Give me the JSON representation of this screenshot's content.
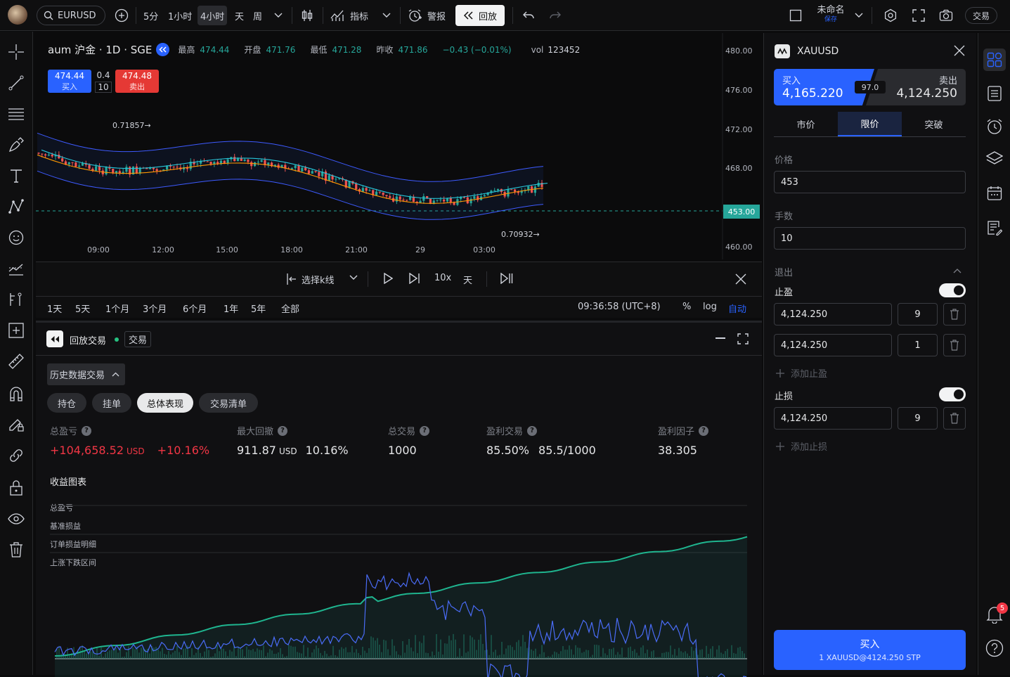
{
  "topbar": {
    "symbol": "EURUSD",
    "intervals": [
      "5分",
      "1小时",
      "4小时",
      "天",
      "周"
    ],
    "active_interval": "4小时",
    "indicators_label": "指标",
    "alert_label": "警报",
    "replay_label": "回放",
    "layout_name": "未命名",
    "layout_sub": "保存",
    "trade_label": "交易"
  },
  "legend": {
    "title": "aum 沪金 · 1D · SGE",
    "high_label": "最高",
    "high": "474.44",
    "open_label": "开盘",
    "open": "471.76",
    "low_label": "最低",
    "low": "471.28",
    "prev_label": "昨收",
    "prev": "471.86",
    "change": "−0.43 (−0.01%)",
    "vol_label": "vol",
    "vol": "123452"
  },
  "quick_trade": {
    "buy_price": "474.44",
    "buy_label": "买入",
    "spread_top": "0.4",
    "spread_bottom": "10",
    "sell_price": "474.48",
    "sell_label": "卖出"
  },
  "chart": {
    "y_ticks": [
      "480.00",
      "476.00",
      "472.00",
      "468.00",
      "460.00"
    ],
    "x_ticks": [
      "09:00",
      "12:00",
      "15:00",
      "18:00",
      "21:00",
      "29",
      "03:00"
    ],
    "current_price": "453.00",
    "annotation_high": "0.71857→",
    "annotation_low": "0.70932→",
    "colors": {
      "up": "#26a69a",
      "down": "#ef5350",
      "band": "#3d5afe",
      "fast": "#ff9800",
      "slow": "#26c6da"
    }
  },
  "replay": {
    "select_bar_label": "选择k线",
    "speed": "10x",
    "step": "天"
  },
  "ranges": {
    "items": [
      "1天",
      "5天",
      "1个月",
      "3个月",
      "6个月",
      "1年",
      "5年",
      "全部"
    ],
    "time": "09:36:58 (UTC+8)",
    "percent": "%",
    "log": "log",
    "auto": "自动"
  },
  "panel": {
    "title": "回放交易",
    "tag": "交易",
    "dropdown": "历史数据交易",
    "tabs": [
      "持仓",
      "挂单",
      "总体表现",
      "交易清单"
    ],
    "active_tab": "总体表现",
    "stats": [
      {
        "label": "总盈亏",
        "value": "+104,658.52",
        "unit": "USD",
        "extra": "+10.16%"
      },
      {
        "label": "最大回撤",
        "value": "911.87",
        "unit": "USD",
        "extra": "10.16%"
      },
      {
        "label": "总交易",
        "value": "1000"
      },
      {
        "label": "盈利交易",
        "value": "85.50%",
        "extra": "85.5/1000"
      },
      {
        "label": "盈利因子",
        "value": "38.305"
      }
    ],
    "equity_title": "收益图表",
    "legend": [
      "总盈亏",
      "基准损益",
      "订单损益明细",
      "上涨下跌区间"
    ]
  },
  "order": {
    "symbol": "XAUUSD",
    "buy_label": "买入",
    "buy_price": "4,165.220",
    "sell_label": "卖出",
    "sell_price": "4,124.250",
    "spread": "97.0",
    "tabs": [
      "市价",
      "限价",
      "突破"
    ],
    "active_tab": "限价",
    "price_label": "价格",
    "price_value": "453",
    "qty_label": "手数",
    "qty_value": "10",
    "exit_label": "退出",
    "tp_label": "止盈",
    "tp_rows": [
      {
        "price": "4,124.250",
        "qty": "9"
      },
      {
        "price": "4,124.250",
        "qty": "1"
      }
    ],
    "add_tp": "添加止盈",
    "sl_label": "止损",
    "sl_rows": [
      {
        "price": "4,124.250",
        "qty": "9"
      }
    ],
    "add_sl": "添加止损",
    "submit_label": "买入",
    "submit_sub": "1 XAUUSD@4124.250 STP"
  },
  "rightbar": {
    "notification_count": "5"
  }
}
